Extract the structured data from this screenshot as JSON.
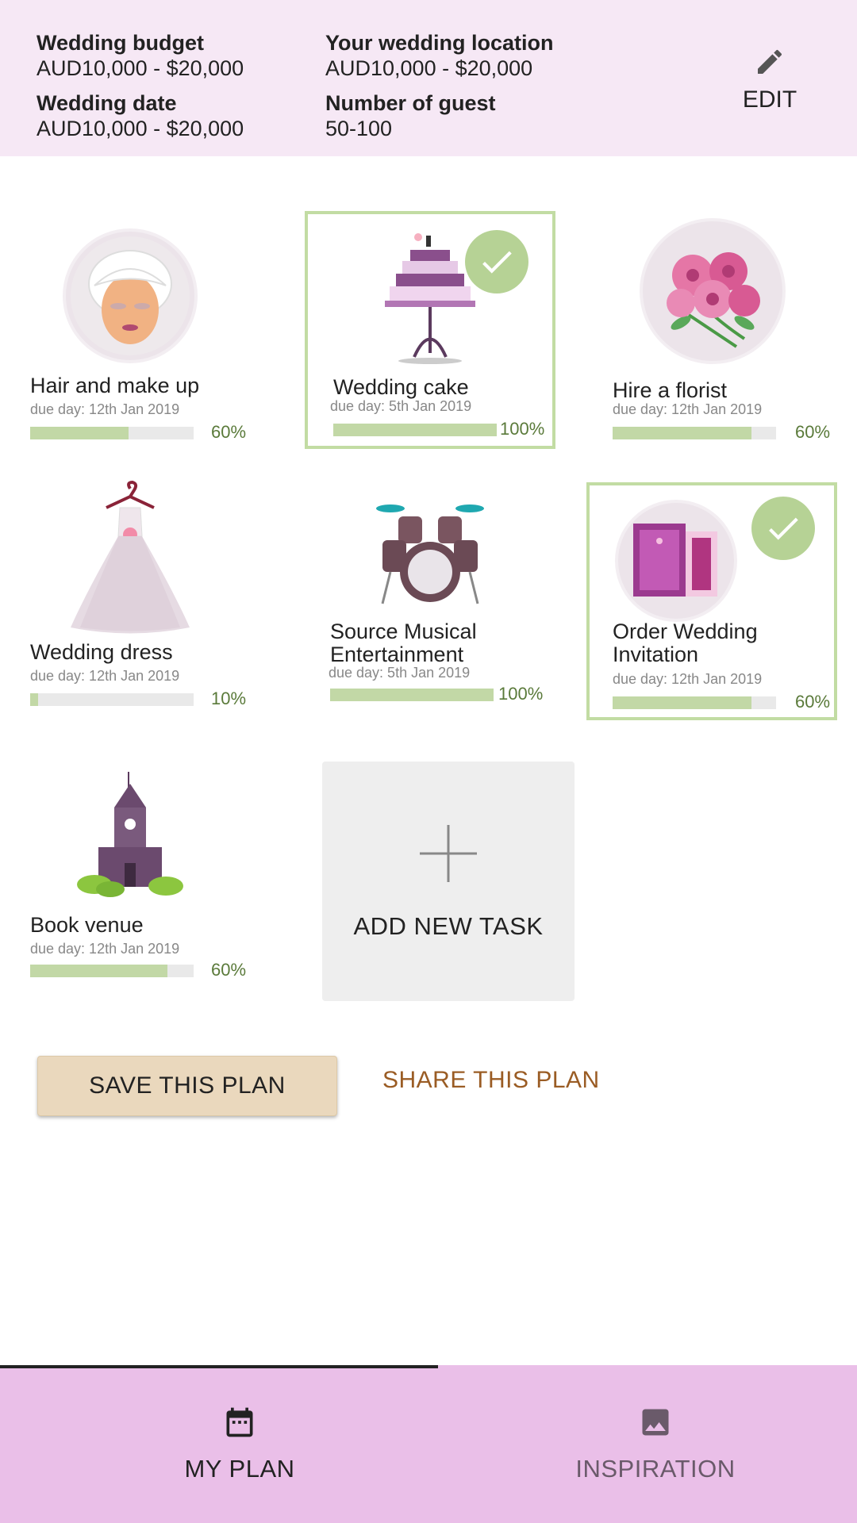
{
  "header": {
    "budget_label": "Wedding budget",
    "budget_value": "AUD10,000 - $20,000",
    "date_label": "Wedding date",
    "date_value": "AUD10,000 - $20,000",
    "location_label": "Your wedding location",
    "location_value": "AUD10,000 - $20,000",
    "guests_label": "Number of guest",
    "guests_value": "50-100",
    "edit_label": "EDIT"
  },
  "tasks": [
    {
      "title": "Hair and make up",
      "due": "due day: 12th Jan 2019",
      "progress": "60%",
      "completed": false,
      "icon": "face-mask-icon"
    },
    {
      "title": "Wedding cake",
      "due": "due day: 5th Jan 2019",
      "progress": "100%",
      "completed": true,
      "icon": "wedding-cake-icon"
    },
    {
      "title": "Hire a florist",
      "due": "due day: 12th Jan 2019",
      "progress": "60%",
      "completed": false,
      "icon": "flowers-icon"
    },
    {
      "title": "Wedding dress",
      "due": "due day: 12th Jan 2019",
      "progress": "10%",
      "completed": false,
      "icon": "dress-icon"
    },
    {
      "title": "Source Musical Entertainment",
      "due": "due day: 5th Jan 2019",
      "progress": "100%",
      "completed": false,
      "icon": "drum-kit-icon"
    },
    {
      "title": "Order Wedding Invitation",
      "due": "due day: 12th Jan 2019",
      "progress": "60%",
      "completed": true,
      "icon": "invitation-icon"
    },
    {
      "title": "Book venue",
      "due": "due day: 12th Jan 2019",
      "progress": "60%",
      "completed": false,
      "icon": "church-icon"
    }
  ],
  "add_task_label": "ADD NEW TASK",
  "actions": {
    "save_label": "SAVE THIS PLAN",
    "share_label": "SHARE THIS PLAN"
  },
  "nav": {
    "my_plan": "MY PLAN",
    "inspiration": "INSPIRATION"
  },
  "colors": {
    "header_bg": "#f6e8f5",
    "nav_bg": "#eabfe8",
    "progress_fill": "#c2d8a6",
    "completed_border": "#c2dca3",
    "check_bg": "#b6d295",
    "save_bg": "#ead8bd",
    "share_text": "#9a5c24"
  }
}
